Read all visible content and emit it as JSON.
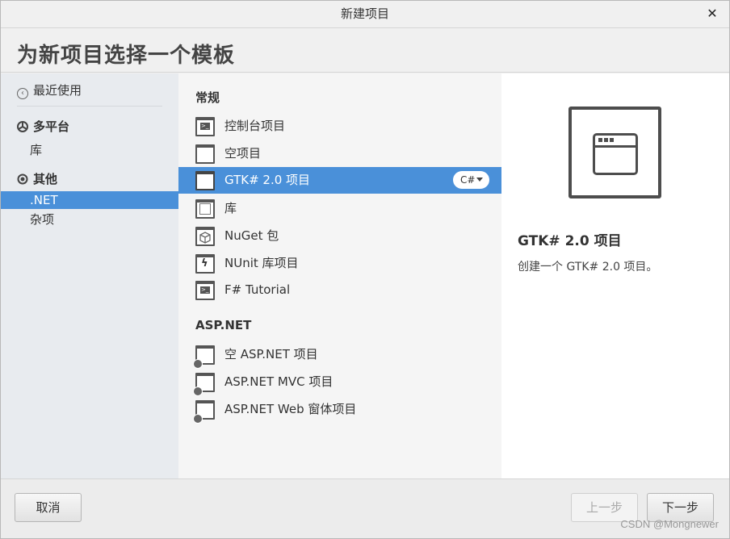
{
  "window": {
    "title": "新建项目"
  },
  "header": {
    "title": "为新项目选择一个模板"
  },
  "sidebar": {
    "recent": "最近使用",
    "categories": [
      {
        "label": "多平台",
        "icon": "multiplatform-icon",
        "items": [
          "库"
        ]
      },
      {
        "label": "其他",
        "icon": "other-icon",
        "items": [
          ".NET",
          "杂项"
        ]
      }
    ],
    "selected": ".NET"
  },
  "templates": {
    "groups": [
      {
        "title": "常规",
        "items": [
          {
            "label": "控制台项目",
            "icon": "console-icon"
          },
          {
            "label": "空项目",
            "icon": "empty-project-icon"
          },
          {
            "label": "GTK# 2.0 项目",
            "icon": "window-icon",
            "selected": true,
            "language": "C#"
          },
          {
            "label": "库",
            "icon": "library-icon"
          },
          {
            "label": "NuGet 包",
            "icon": "nuget-package-icon"
          },
          {
            "label": "NUnit 库项目",
            "icon": "nunit-icon"
          },
          {
            "label": "F# Tutorial",
            "icon": "console-icon"
          }
        ]
      },
      {
        "title": "ASP.NET",
        "items": [
          {
            "label": "空 ASP.NET 项目",
            "icon": "web-project-icon"
          },
          {
            "label": "ASP.NET MVC 项目",
            "icon": "web-project-icon"
          },
          {
            "label": "ASP.NET Web 窗体项目",
            "icon": "web-project-icon"
          }
        ]
      }
    ]
  },
  "preview": {
    "title": "GTK# 2.0 项目",
    "description": "创建一个 GTK# 2.0 项目。",
    "icon": "window-icon"
  },
  "footer": {
    "cancel": "取消",
    "back": "上一步",
    "next": "下一步"
  },
  "watermark": "CSDN @Mongnewer",
  "colors": {
    "selection": "#4a90d9"
  }
}
